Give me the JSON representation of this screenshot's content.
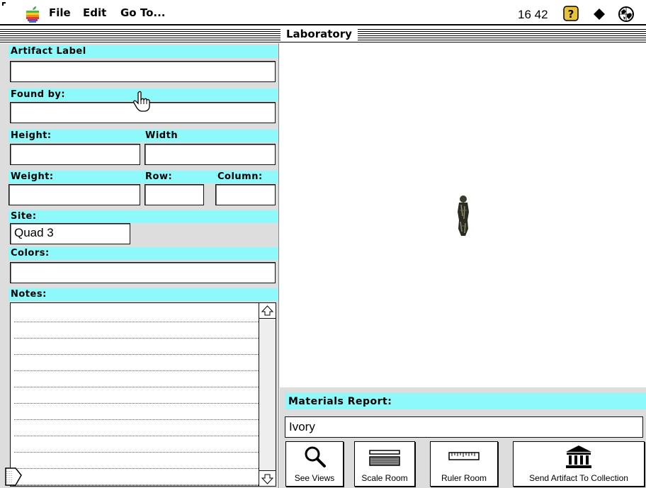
{
  "menubar": {
    "apple_icon": "apple-logo-icon",
    "items": [
      "File",
      "Edit",
      "Go To..."
    ],
    "clock": "16 42",
    "icons": [
      "help-icon",
      "diamond-icon",
      "globe-icon"
    ]
  },
  "window": {
    "title": "Laboratory"
  },
  "form": {
    "artifact_label": {
      "label": "Artifact Label",
      "value": ""
    },
    "found_by": {
      "label": "Found by:",
      "value": ""
    },
    "height": {
      "label": "Height:",
      "value": ""
    },
    "width": {
      "label": "Width",
      "value": ""
    },
    "weight": {
      "label": "Weight:",
      "value": ""
    },
    "row": {
      "label": "Row:",
      "value": ""
    },
    "column": {
      "label": "Column:",
      "value": ""
    },
    "site": {
      "label": "Site:",
      "value": "Quad 3"
    },
    "colors": {
      "label": "Colors:",
      "value": ""
    },
    "notes": {
      "label": "Notes:",
      "value": ""
    }
  },
  "materials": {
    "label": "Materials Report:",
    "value": "Ivory"
  },
  "buttons": {
    "see_views": "See Views",
    "scale_room": "Scale Room",
    "ruler_room": "Ruler Room",
    "send_to_collection": "Send Artifact To Collection"
  },
  "colors": {
    "label_band": "#8ef9fb",
    "panel_bg": "#dddddd"
  }
}
